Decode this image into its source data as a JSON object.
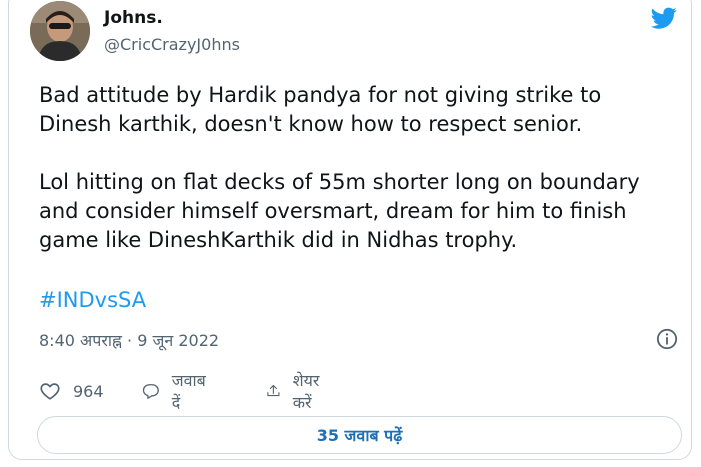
{
  "author": {
    "name": "Johns.",
    "handle": "@CricCrazyJ0hns"
  },
  "tweet": {
    "lines_para1": [
      "Bad attitude by Hardik pandya for not giving strike to",
      "Dinesh karthik, doesn't know how to respect senior."
    ],
    "lines_para2": [
      "Lol hitting on flat decks of 55m shorter long on boundary",
      "and consider himself oversmart, dream for him to finish",
      "game like DineshKarthik did in Nidhas trophy."
    ],
    "hashtag": "#INDvsSA",
    "timestamp": "8:40 अपराह्न · 9 जून 2022"
  },
  "actions": {
    "like_count": "964",
    "reply_label": "जवाब दें",
    "share_label": "शेयर करें"
  },
  "read_replies_label": "35 जवाब पढ़ें",
  "colors": {
    "accent": "#1d9bf0",
    "text": "#0f1419",
    "secondary": "#536471",
    "border": "#cfd9de"
  },
  "icons": [
    "twitter-bird-icon",
    "info-icon",
    "heart-icon",
    "reply-icon",
    "share-icon"
  ]
}
